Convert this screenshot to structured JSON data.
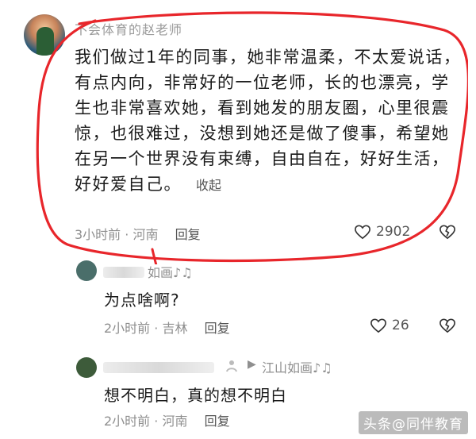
{
  "main_comment": {
    "username": "不会体育的赵老师",
    "text": "我们做过1年的同事，她非常温柔，不太爱说话，有点内向，非常好的一位老师，长的也漂亮，学生也非常喜欢她，看到她发的朋友圈，心里很震惊，也很难过，没想到她还是做了傻事，希望她在另一个世界没有束缚，自由自在，好好生活，好好爱自己。",
    "collapse_label": "收起",
    "time": "3小时前",
    "location": "河南",
    "reply_label": "回复",
    "likes": "2902"
  },
  "replies": [
    {
      "username": "如画♪♫",
      "text": "为点啥啊?",
      "time": "2小时前",
      "location": "吉林",
      "reply_label": "回复",
      "likes": "26"
    },
    {
      "username": "江山如画♪♫",
      "text": "想不明白，真的想不明白",
      "time": "2小时前",
      "location": "河南",
      "reply_label": "回复",
      "likes": ""
    }
  ],
  "watermark": "头条@同伴教育",
  "colors": {
    "annotation": "#e8262b",
    "text": "#1b1b1b",
    "meta": "#8f8f8f"
  },
  "icons": {
    "like": "heart-outline-icon",
    "dislike": "broken-heart-icon"
  }
}
